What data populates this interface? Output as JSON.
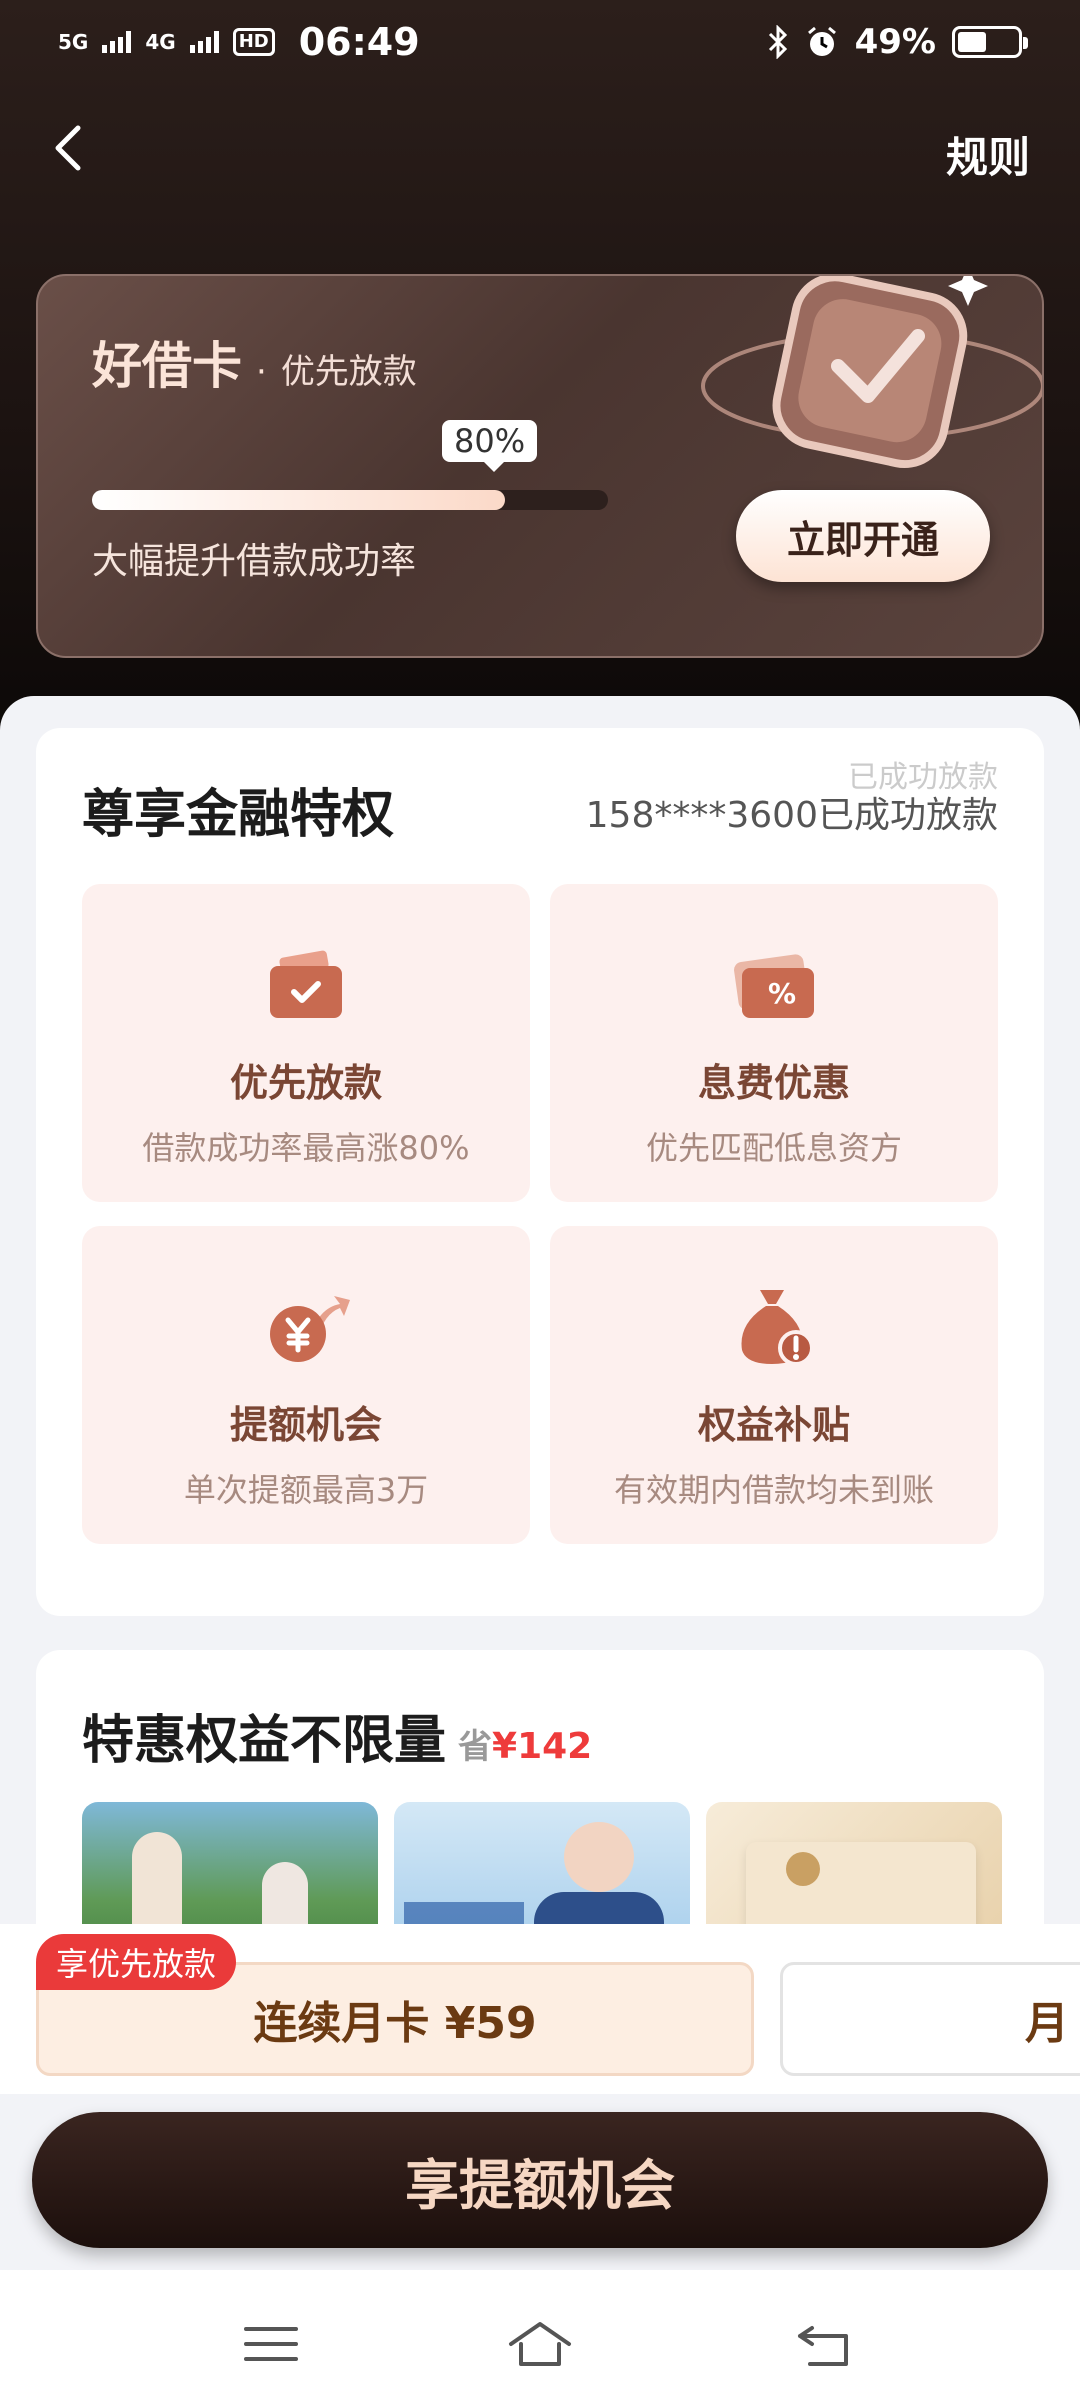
{
  "status_bar": {
    "signal1": "5G",
    "signal2": "4G",
    "hd": "HD",
    "time": "06:49",
    "battery": "49%"
  },
  "header": {
    "rules_label": "规则"
  },
  "vip_card": {
    "name": "好借卡",
    "separator": "·",
    "subtitle": "优先放款",
    "progress_label": "80%",
    "progress_value": 0.8,
    "description": "大幅提升借款成功率",
    "activate_label": "立即开通"
  },
  "privileges": {
    "title": "尊享金融特权",
    "ticker": "158****3600已成功放款",
    "ticker_prev": "已成功放款",
    "items": [
      {
        "name": "优先放款",
        "desc": "借款成功率最高涨80%",
        "icon": "wallet-check-icon"
      },
      {
        "name": "息费优惠",
        "desc": "优先匹配低息资方",
        "icon": "coupon-percent-icon"
      },
      {
        "name": "提额机会",
        "desc": "单次提额最高3万",
        "icon": "yuan-arrow-icon"
      },
      {
        "name": "权益补贴",
        "desc": "有效期内借款均未到账",
        "icon": "money-bag-alert-icon"
      }
    ]
  },
  "deals": {
    "title": "特惠权益不限量",
    "save_prefix": "省",
    "save_amount": "¥142"
  },
  "plans": {
    "tag": "享优先放款",
    "main_label": "连续月卡 ¥59",
    "second_label": "月"
  },
  "cta": {
    "label": "享提额机会"
  },
  "colors": {
    "accent_dark": "#1c0f0c",
    "accent_red": "#ea3a3a",
    "card_bg": "#fdf0ee"
  }
}
